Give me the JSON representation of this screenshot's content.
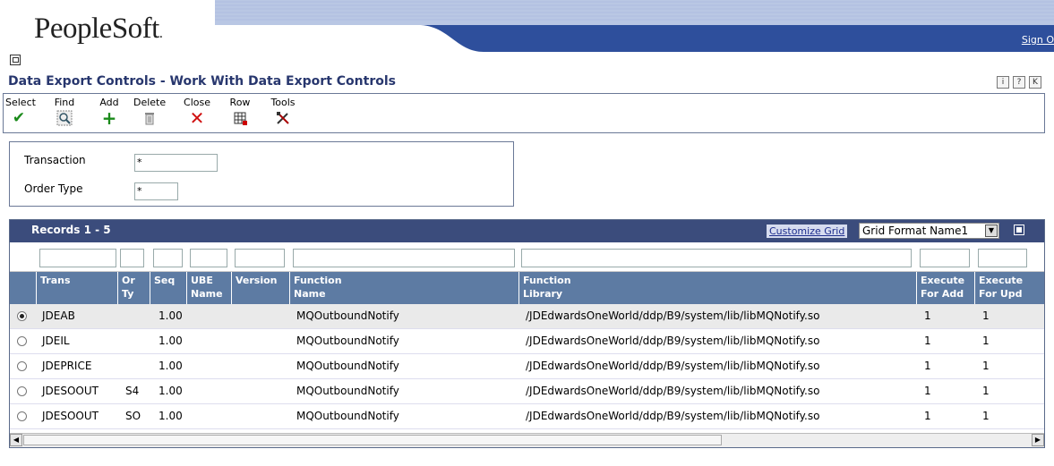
{
  "header": {
    "logo": "PeopleSoft",
    "logo_dot": ".",
    "sign_out": "Sign O"
  },
  "page_title": "Data Export Controls - Work With Data Export Controls",
  "help_icons": [
    "i",
    "?",
    "K"
  ],
  "toolbar": {
    "select": "Select",
    "find": "Find",
    "add": "Add",
    "delete": "Delete",
    "close": "Close",
    "row": "Row",
    "tools": "Tools"
  },
  "criteria": {
    "transaction_label": "Transaction",
    "transaction_value": "*",
    "order_type_label": "Order Type",
    "order_type_value": "*"
  },
  "grid": {
    "records": "Records 1 - 5",
    "customize": "Customize Grid",
    "format": "Grid Format Name1",
    "columns": [
      {
        "l1": "",
        "l2": "Trans"
      },
      {
        "l1": "Or",
        "l2": "Ty"
      },
      {
        "l1": "",
        "l2": "Seq"
      },
      {
        "l1": "UBE",
        "l2": "Name"
      },
      {
        "l1": "",
        "l2": "Version"
      },
      {
        "l1": "Function",
        "l2": "Name"
      },
      {
        "l1": "Function",
        "l2": "Library"
      },
      {
        "l1": "Execute",
        "l2": "For Add"
      },
      {
        "l1": "Execute",
        "l2": "For Upd"
      }
    ],
    "rows": [
      {
        "trans": "JDEAB",
        "ty": "",
        "seq": "1.00",
        "fname": "MQOutboundNotify",
        "flib": "/JDEdwardsOneWorld/ddp/B9/system/lib/libMQNotify.so",
        "add": "1",
        "upd": "1"
      },
      {
        "trans": "JDEIL",
        "ty": "",
        "seq": "1.00",
        "fname": "MQOutboundNotify",
        "flib": "/JDEdwardsOneWorld/ddp/B9/system/lib/libMQNotify.so",
        "add": "1",
        "upd": "1"
      },
      {
        "trans": "JDEPRICE",
        "ty": "",
        "seq": "1.00",
        "fname": "MQOutboundNotify",
        "flib": "/JDEdwardsOneWorld/ddp/B9/system/lib/libMQNotify.so",
        "add": "1",
        "upd": "1"
      },
      {
        "trans": "JDESOOUT",
        "ty": "S4",
        "seq": "1.00",
        "fname": "MQOutboundNotify",
        "flib": "/JDEdwardsOneWorld/ddp/B9/system/lib/libMQNotify.so",
        "add": "1",
        "upd": "1"
      },
      {
        "trans": "JDESOOUT",
        "ty": "SO",
        "seq": "1.00",
        "fname": "MQOutboundNotify",
        "flib": "/JDEdwardsOneWorld/ddp/B9/system/lib/libMQNotify.so",
        "add": "1",
        "upd": "1"
      }
    ]
  },
  "colors": {
    "header_bar": "#3b4c7c",
    "column_header": "#5d7ba3",
    "title": "#28376e",
    "banner": "#2e4f9c"
  }
}
